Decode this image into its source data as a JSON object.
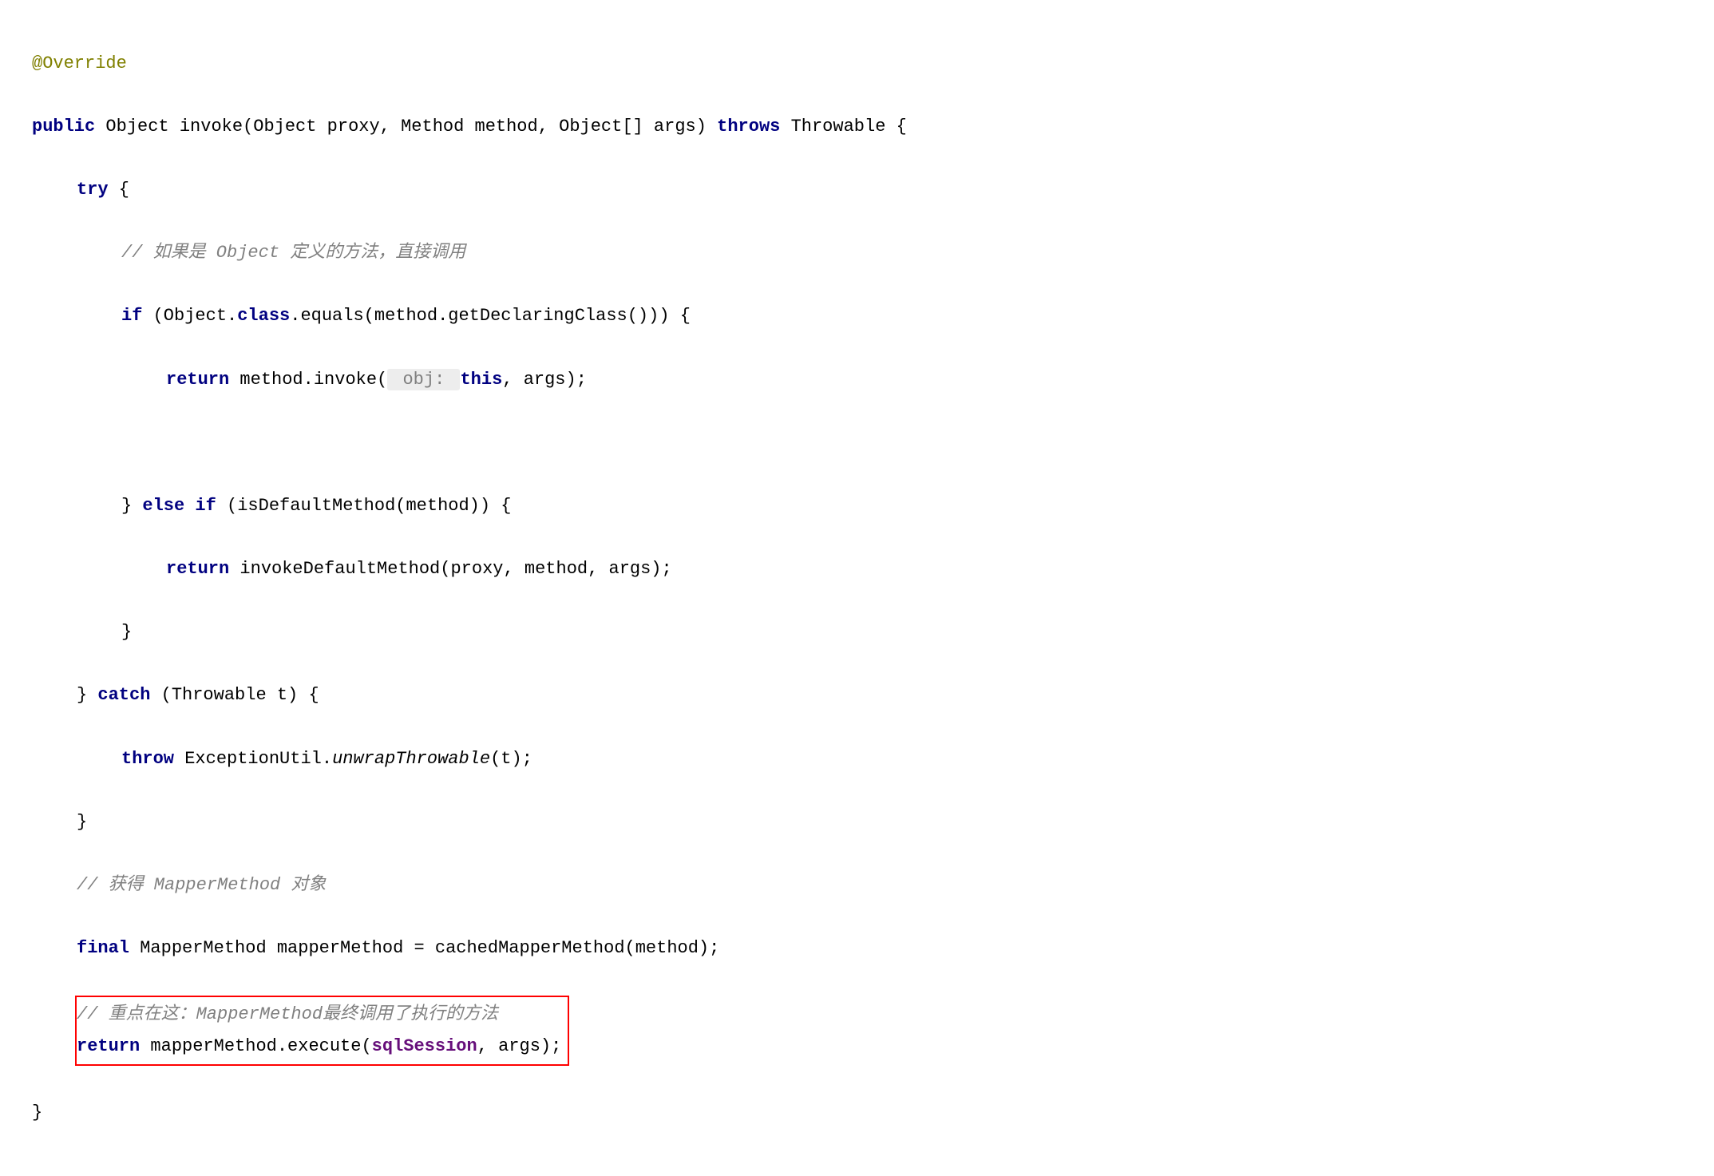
{
  "code": {
    "annotation": "@Override",
    "sig_kw_public": "public",
    "sig_type": " Object invoke(Object proxy, Method method, Object[] args) ",
    "sig_kw_throws": "throws",
    "sig_throws_type": " Throwable {",
    "try_kw": "try",
    "try_open": " {",
    "comment1": "// 如果是 Object 定义的方法，直接调用",
    "if_kw": "if",
    "if_open": " (Object.",
    "class_kw": "class",
    "if_rest": ".equals(method.getDeclaringClass())) {",
    "return_kw1": "return",
    "return1_a": " method.invoke(",
    "obj_hint": " obj: ",
    "this_kw": "this",
    "return1_b": ", args);",
    "else_close": "} ",
    "else_kw": "else if",
    "else_cond": " (isDefaultMethod(method)) {",
    "return_kw2": "return",
    "return2_rest": " invokeDefaultMethod(proxy, method, args);",
    "close_brace": "}",
    "catch_close": "} ",
    "catch_kw": "catch",
    "catch_cond": " (Throwable t) {",
    "throw_kw": "throw",
    "throw_a": " ExceptionUtil.",
    "throw_call": "unwrapThrowable",
    "throw_b": "(t);",
    "comment2": "// 获得 MapperMethod 对象",
    "final_kw": "final",
    "final_rest": " MapperMethod mapperMethod = cachedMapperMethod(method);",
    "comment3": "// 重点在这：MapperMethod最终调用了执行的方法",
    "return_kw3": "return",
    "return3_a": " mapperMethod.execute(",
    "sqlSession": "sqlSession",
    "return3_b": ", args);"
  }
}
